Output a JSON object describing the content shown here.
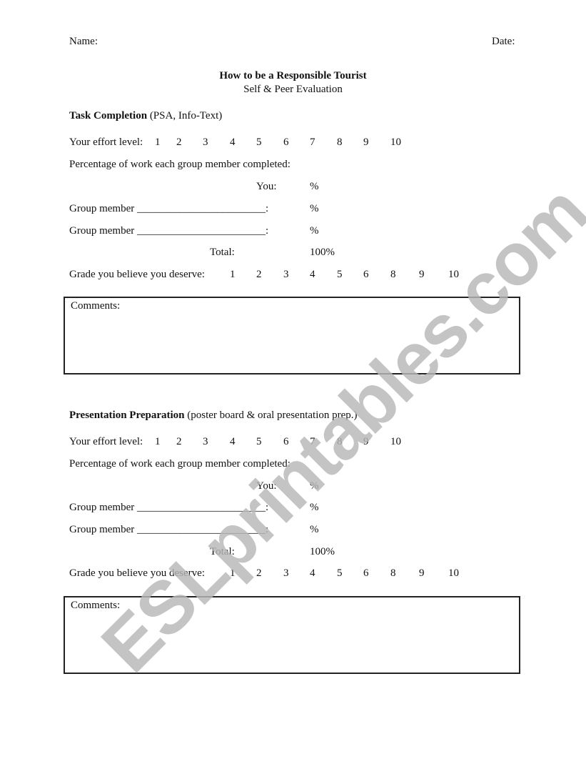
{
  "header": {
    "name_label": "Name:",
    "date_label": "Date:"
  },
  "title": "How to be a Responsible Tourist",
  "subtitle": "Self & Peer Evaluation",
  "effort_scale": [
    "1",
    "2",
    "3",
    "4",
    "5",
    "6",
    "7",
    "8",
    "9",
    "10"
  ],
  "grade_scale": [
    "1",
    "2",
    "3",
    "4",
    "5",
    "6",
    "8",
    "9",
    "10"
  ],
  "sections": [
    {
      "heading_bold": "Task Completion",
      "heading_note": "(PSA, Info-Text)",
      "effort_label": "Your effort level:",
      "percentage_label": "Percentage of work each group member completed:",
      "you_label": "You:",
      "you_value": "%",
      "member_label": "Group member ________________________:",
      "member_value": "%",
      "total_label": "Total:",
      "total_value": "100%",
      "grade_label": "Grade you believe you deserve:",
      "comments_label": "Comments:"
    },
    {
      "heading_bold": "Presentation Preparation",
      "heading_note": "(poster board & oral presentation prep.)",
      "effort_label": "Your effort level:",
      "percentage_label": "Percentage of work each group member completed:",
      "you_label": "You:",
      "you_value": "%",
      "member_label": "Group member ________________________:",
      "member_value": "%",
      "total_label": "Total:",
      "total_value": "100%",
      "grade_label": "Grade you believe you deserve:",
      "comments_label": "Comments:"
    }
  ],
  "watermark": "ESLprintables.com"
}
